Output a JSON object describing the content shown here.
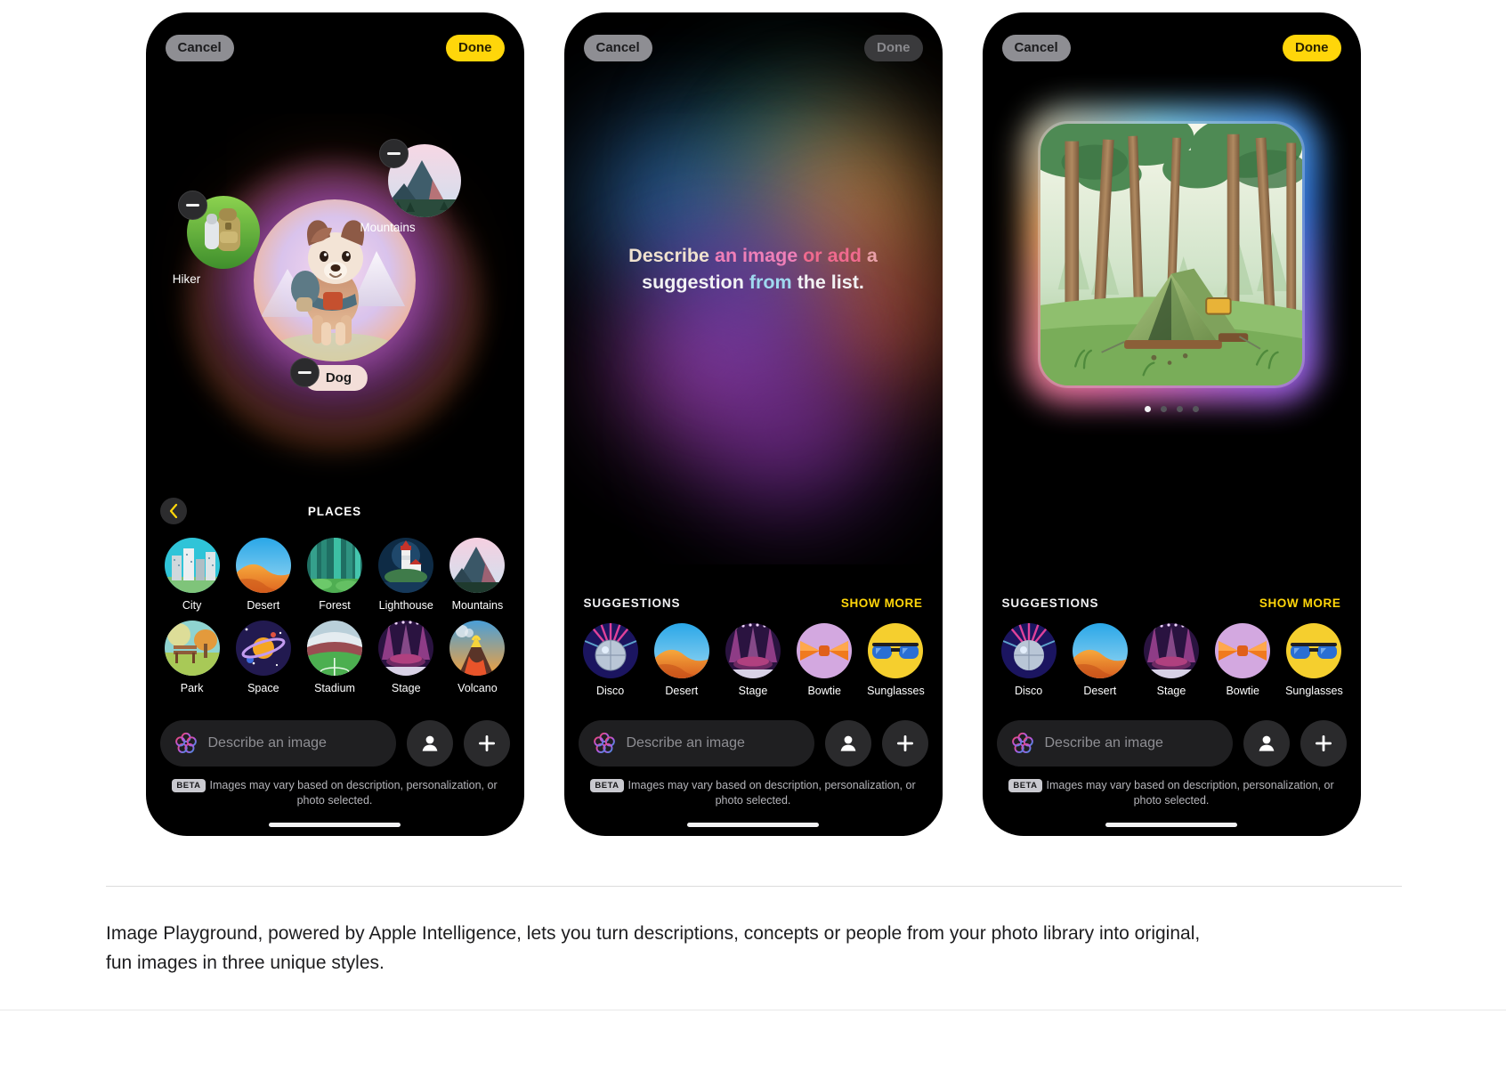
{
  "screens": [
    {
      "id": "concepts",
      "topbar": {
        "cancel": "Cancel",
        "done": "Done",
        "done_enabled": true
      },
      "concepts": [
        {
          "label": "Hiker",
          "remove": "remove-concept"
        },
        {
          "label": "Mountains",
          "remove": "remove-concept"
        },
        {
          "label": "Dog",
          "remove": "remove-concept"
        }
      ],
      "category": {
        "title": "PLACES",
        "back_icon": "chevron-left-icon",
        "rows": [
          [
            "City",
            "Desert",
            "Forest",
            "Lighthouse",
            "Mountains"
          ],
          [
            "Park",
            "Space",
            "Stadium",
            "Stage",
            "Volcano"
          ]
        ]
      },
      "input": {
        "placeholder": "Describe an image",
        "ai_icon": "apple-intelligence-icon",
        "person_icon": "person-icon",
        "plus_icon": "plus-icon"
      },
      "disclaimer": {
        "badge": "BETA",
        "text": "Images may vary based on description, personalization, or photo selected."
      }
    },
    {
      "id": "empty-prompt",
      "topbar": {
        "cancel": "Cancel",
        "done": "Done",
        "done_enabled": false
      },
      "prompt_lines": [
        [
          {
            "t": "Describe ",
            "c": "#f0e2cf"
          },
          {
            "t": "an image ",
            "c": "#ef7fb8"
          },
          {
            "t": "or add ",
            "c": "#f06a8e"
          },
          {
            "t": "a",
            "c": "#e9a0a8"
          }
        ],
        [
          {
            "t": "suggestion ",
            "c": "#f2f2f4"
          },
          {
            "t": "from ",
            "c": "#9fd8ef"
          },
          {
            "t": "the list.",
            "c": "#f2f2f4"
          }
        ]
      ],
      "suggestions": {
        "title": "SUGGESTIONS",
        "show_more": "SHOW MORE",
        "items": [
          "Disco",
          "Desert",
          "Stage",
          "Bowtie",
          "Sunglasses"
        ]
      },
      "input": {
        "placeholder": "Describe an image",
        "ai_icon": "apple-intelligence-icon",
        "person_icon": "person-icon",
        "plus_icon": "plus-icon"
      },
      "disclaimer": {
        "badge": "BETA",
        "text": "Images may vary based on description, personalization, or photo selected."
      }
    },
    {
      "id": "result",
      "topbar": {
        "cancel": "Cancel",
        "done": "Done",
        "done_enabled": true
      },
      "result": {
        "alt": "illustrated green tent camping in a forest",
        "page_count": 4,
        "page_active": 1
      },
      "suggestions": {
        "title": "SUGGESTIONS",
        "show_more": "SHOW MORE",
        "items": [
          "Disco",
          "Desert",
          "Stage",
          "Bowtie",
          "Sunglasses"
        ]
      },
      "input": {
        "placeholder": "Describe an image",
        "ai_icon": "apple-intelligence-icon",
        "person_icon": "person-icon",
        "plus_icon": "plus-icon"
      },
      "disclaimer": {
        "badge": "BETA",
        "text": "Images may vary based on description, personalization, or photo selected."
      }
    }
  ],
  "footer": {
    "caption": "Image Playground, powered by Apple Intelligence, lets you turn descriptions, concepts or people from your photo library into original, fun images in three unique styles."
  },
  "colors": {
    "accent_yellow": "#ffd60a",
    "cancel_gray": "#8e8e93",
    "phone_bg": "#000000",
    "field_bg": "#1f1f21",
    "placeholder": "#8e8e93"
  }
}
